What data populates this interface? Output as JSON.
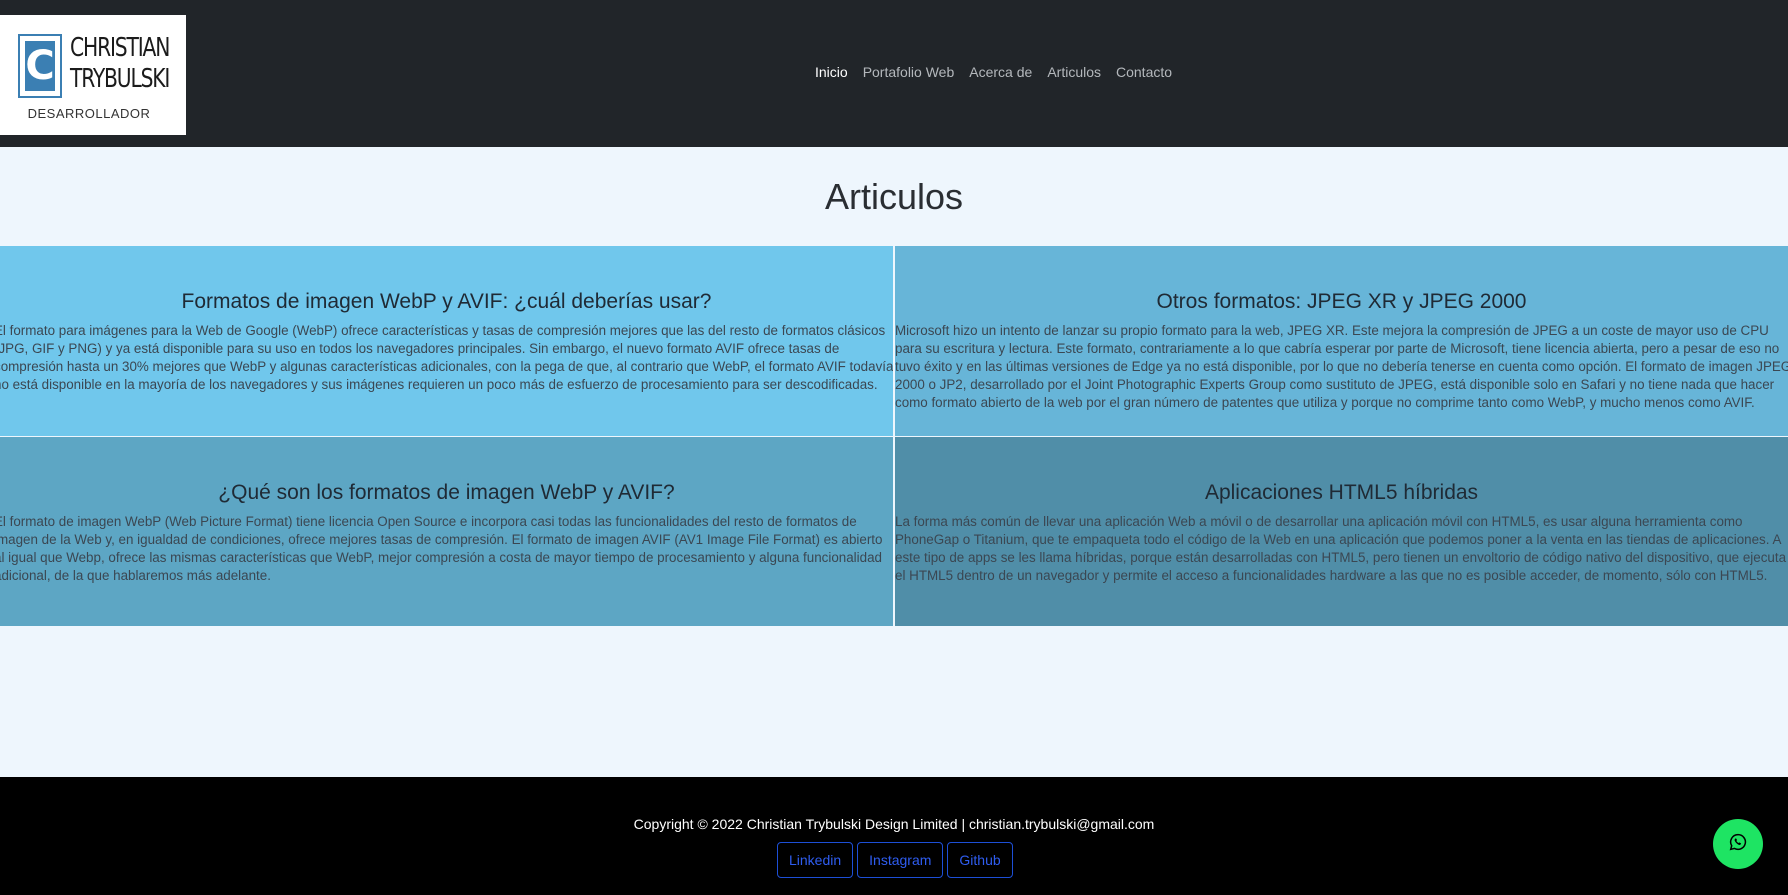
{
  "header": {
    "logo": {
      "letter": "C",
      "name_line1": "CHRISTIAN",
      "name_line2": "TRYBULSKI",
      "subtitle": "DESARROLLADOR"
    },
    "nav": [
      {
        "label": "Inicio",
        "active": true
      },
      {
        "label": "Portafolio Web",
        "active": false
      },
      {
        "label": "Acerca de",
        "active": false
      },
      {
        "label": "Articulos",
        "active": false
      },
      {
        "label": "Contacto",
        "active": false
      }
    ]
  },
  "main": {
    "title": "Articulos",
    "articles": [
      {
        "title": "Formatos de imagen WebP y AVIF: ¿cuál deberías usar?",
        "body": "El formato para imágenes para la Web de Google (WebP) ofrece características y tasas de compresión mejores que las del resto de formatos clásicos (JPG, GIF y PNG) y ya está disponible para su uso en todos los navegadores principales. Sin embargo, el nuevo formato AVIF ofrece tasas de compresión hasta un 30% mejores que WebP y algunas características adicionales, con la pega de que, al contrario que WebP, el formato AVIF todavía no está disponible en la mayoría de los navegadores y sus imágenes requieren un poco más de esfuerzo de procesamiento para ser descodificadas."
      },
      {
        "title": "Otros formatos: JPEG XR y JPEG 2000",
        "body": "Microsoft hizo un intento de lanzar su propio formato para la web, JPEG XR. Este mejora la compresión de JPEG a un coste de mayor uso de CPU para su escritura y lectura. Este formato, contrariamente a lo que cabría esperar por parte de Microsoft, tiene licencia abierta, pero a pesar de eso no tuvo éxito y en las últimas versiones de Edge ya no está disponible, por lo que no debería tenerse en cuenta como opción. El formato de imagen JPEG 2000 o JP2, desarrollado por el Joint Photographic Experts Group como sustituto de JPEG, está disponible solo en Safari y no tiene nada que hacer como formato abierto de la web por el gran número de patentes que utiliza y porque no comprime tanto como WebP, y mucho menos como AVIF."
      },
      {
        "title": "¿Qué son los formatos de imagen WebP y AVIF?",
        "body": "El formato de imagen WebP (Web Picture Format) tiene licencia Open Source e incorpora casi todas las funcionalidades del resto de formatos de imagen de la Web y, en igualdad de condiciones, ofrece mejores tasas de compresión. El formato de imagen AVIF (AV1 Image File Format) es abierto al igual que Webp, ofrece las mismas características que WebP, mejor compresión a costa de mayor tiempo de procesamiento y alguna funcionalidad adicional, de la que hablaremos más adelante."
      },
      {
        "title": "Aplicaciones HTML5 híbridas",
        "body": "La forma más común de llevar una aplicación Web a móvil o de desarrollar una aplicación móvil con HTML5, es usar alguna herramienta como PhoneGap o Titanium, que te empaqueta todo el código de la Web en una aplicación que podemos poner a la venta en las tiendas de aplicaciones. A este tipo de apps se les llama híbridas, porque están desarrolladas con HTML5, pero tienen un envoltorio de código nativo del dispositivo, que ejecuta el HTML5 dentro de un navegador y permite el acceso a funcionalidades hardware a las que no es posible acceder, de momento, sólo con HTML5."
      }
    ]
  },
  "footer": {
    "copyright": "Copyright © 2022 Christian Trybulski Design Limited | christian.trybulski@gmail.com",
    "social": [
      {
        "label": "Linkedin"
      },
      {
        "label": "Instagram"
      },
      {
        "label": "Github"
      }
    ]
  },
  "floating": {
    "whatsapp_icon": "whatsapp-icon",
    "color": "#1ee463"
  }
}
